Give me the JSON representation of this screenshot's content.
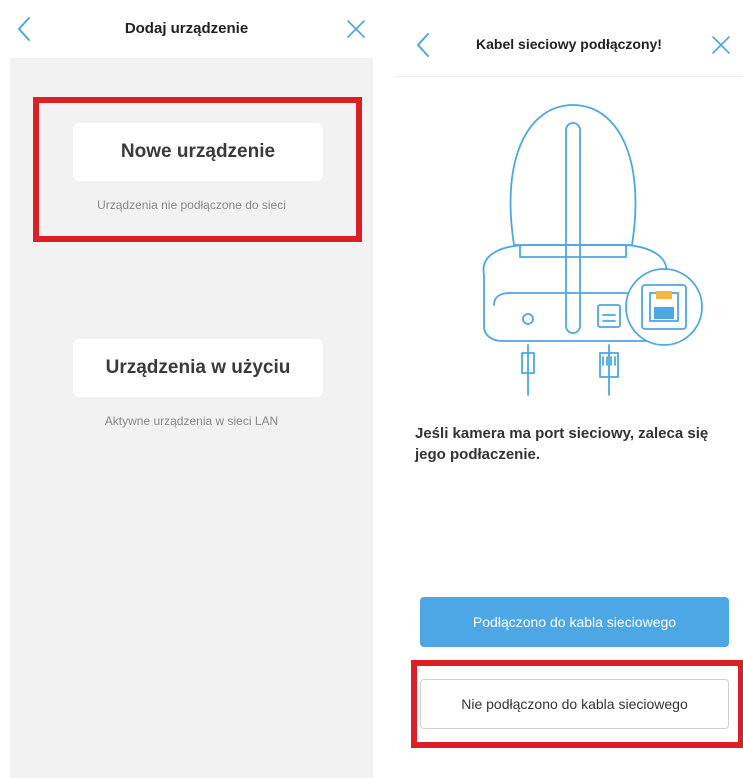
{
  "left": {
    "title": "Dodaj urządzenie",
    "new_device": {
      "label": "Nowe urządzenie",
      "subtitle": "Urządzenia nie podłączone do sieci"
    },
    "used_device": {
      "label": "Urządzenia w użyciu",
      "subtitle": "Aktywne urządzenia w sieci LAN"
    }
  },
  "right": {
    "title": "Kabel sieciowy podłączony!",
    "description": "Jeśli kamera ma port sieciowy, zaleca się jego podłaczenie.",
    "primary_button": "Podłączono do kabla sieciowego",
    "secondary_button": "Nie podłączono do kabla sieciowego"
  },
  "colors": {
    "accent": "#4ca7e4",
    "highlight": "#dc1f26",
    "background_gray": "#f2f2f2",
    "icon": "#4ca7e4",
    "ethernet_port": "#f3b73a"
  },
  "icons": {
    "back": "chevron-left-icon",
    "close": "close-icon"
  }
}
